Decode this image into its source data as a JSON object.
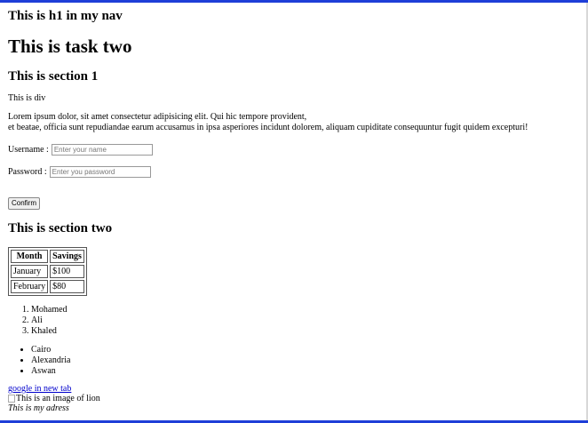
{
  "nav": {
    "heading": "This is h1 in my nav"
  },
  "main": {
    "title": "This is task two"
  },
  "section1": {
    "heading": "This is section 1",
    "div_text": "This is div",
    "lorem_line1": "Lorem ipsum dolor, sit amet consectetur adipisicing elit. Qui hic tempore provident,",
    "lorem_line2": "et beatae, officia sunt repudiandae earum accusamus in ipsa asperiores incidunt dolorem, aliquam cupiditate consequuntur fugit quidem excepturi!",
    "username_label": "Username :",
    "username_value": "",
    "username_placeholder": "Enter your name",
    "password_label": "Password :",
    "password_value": "",
    "password_placeholder": "Enter you password",
    "confirm_label": "Confirm"
  },
  "section2": {
    "heading": "This is section two",
    "table": {
      "headers": [
        "Month",
        "Savings"
      ],
      "rows": [
        [
          "January",
          "$100"
        ],
        [
          "February",
          "$80"
        ]
      ]
    },
    "ordered_list": [
      "Mohamed",
      "Ali",
      "Khaled"
    ],
    "unordered_list": [
      "Cairo",
      "Alexandria",
      "Aswan"
    ]
  },
  "footer": {
    "link_text": "google in new tab",
    "image_alt": "This is an image of lion",
    "address": "This is my adress"
  }
}
